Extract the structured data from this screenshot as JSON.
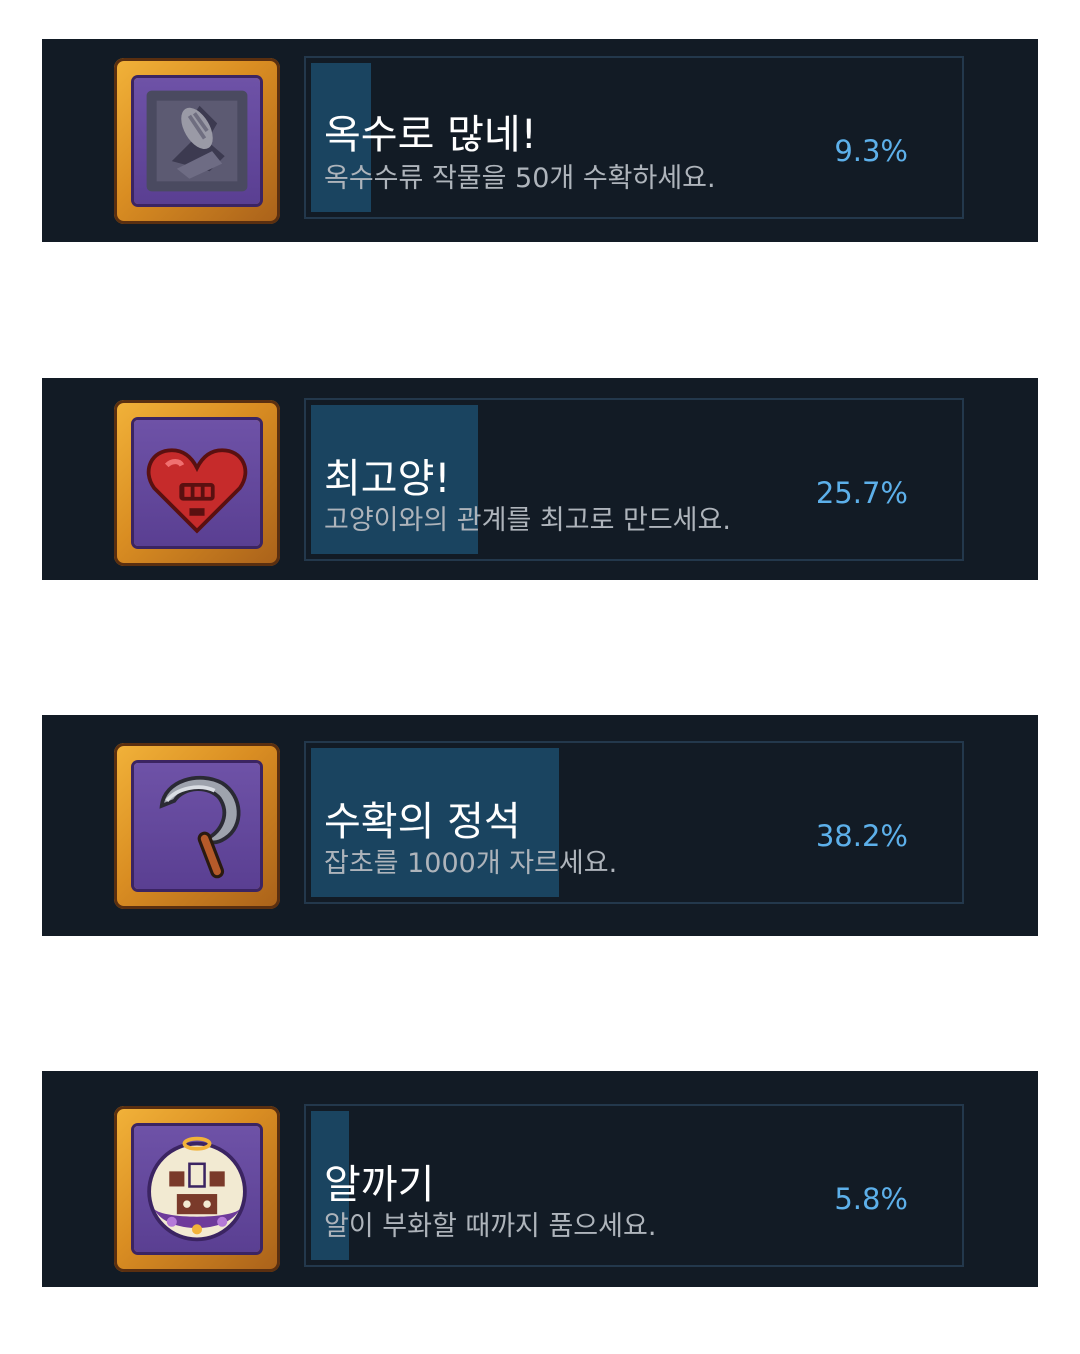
{
  "achievements": [
    {
      "title": "옥수로 많네!",
      "description": "옥수수류 작물을 50개 수확하세요.",
      "percent_label": "9.3%",
      "percent_value": 9.3,
      "icon": "corn-icon"
    },
    {
      "title": "최고양!",
      "description": "고양이와의 관계를 최고로 만드세요.",
      "percent_label": "25.7%",
      "percent_value": 25.7,
      "icon": "cat-heart-icon"
    },
    {
      "title": "수확의 정석",
      "description": "잡초를 1000개 자르세요.",
      "percent_label": "38.2%",
      "percent_value": 38.2,
      "icon": "sickle-icon"
    },
    {
      "title": "알까기",
      "description": "알이 부화할 때까지 품으세요.",
      "percent_label": "5.8%",
      "percent_value": 5.8,
      "icon": "egg-hatch-icon"
    }
  ],
  "colors": {
    "card_background": "#121b25",
    "progress_fill": "#1a4460",
    "percent_text": "#5db0ea",
    "frame_gold": "#e09a2a",
    "icon_background": "#5a3f92"
  }
}
